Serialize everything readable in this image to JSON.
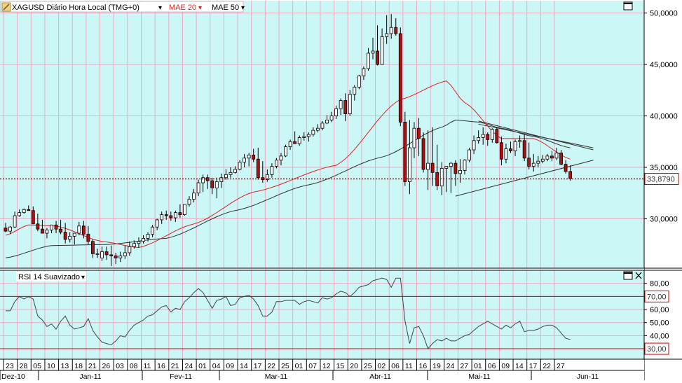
{
  "header": {
    "symbol": "XAGUSD",
    "period": "Diário",
    "timezone": "Hora Local (TMG+0)",
    "indicators": [
      {
        "label": "MAE 20",
        "color": "#e02020"
      },
      {
        "label": "MAE 50",
        "color": "#000000"
      }
    ],
    "dropdown_glyph": "▾"
  },
  "rsi_panel": {
    "label": "RSI 14 Suavizado"
  },
  "colors": {
    "plot_background": "#ccf7f7",
    "grid": "#f0a8c0",
    "bull": "#ffffff",
    "bear": "#b01010",
    "candle_outline": "#000000",
    "mae20": "#e02020",
    "mae50": "#303030",
    "last_price_line": "#cc0000",
    "rsi_line": "#444444",
    "rsi_levels": "#cc0000"
  },
  "chart_data": [
    {
      "type": "candlestick",
      "title": "XAGUSD Diário Hora Local (TMG+0)",
      "y_axis_side": "right",
      "yticks": [
        30,
        35,
        40,
        45,
        50
      ],
      "ytick_labels": [
        "30,0000",
        "35,0000",
        "40,0000",
        "45,0000",
        "50,0000"
      ],
      "ylim": [
        25.2,
        51.2
      ],
      "last_price": 33.879,
      "last_price_label": "33,8790",
      "x_labels": {
        "days": [
          "23",
          "28",
          "05",
          "10",
          "13",
          "18",
          "21",
          "26",
          "03",
          "08",
          "11",
          "16",
          "21",
          "24",
          "01",
          "04",
          "09",
          "14",
          "17",
          "22",
          "25",
          "01",
          "07",
          "12",
          "15",
          "20",
          "25",
          "02",
          "06",
          "11",
          "16",
          "19",
          "24",
          "27",
          "01",
          "06",
          "09",
          "14",
          "17",
          "22",
          "27"
        ],
        "months": [
          "Dez-10",
          "Jan-11",
          "Fev-11",
          "Mar-11",
          "Abr-11",
          "Mai-11",
          "Jun-11"
        ]
      },
      "series": [
        {
          "kind": "ohlc",
          "open": [
            29.1,
            28.8,
            29.2,
            30.3,
            30.6,
            30.9,
            30.8,
            29.5,
            29.0,
            28.6,
            28.9,
            29.4,
            29.0,
            28.7,
            28.0,
            28.3,
            28.6,
            29.3,
            28.5,
            27.8,
            26.6,
            26.2,
            26.8,
            26.5,
            26.4,
            26.2,
            26.4,
            26.7,
            27.3,
            27.6,
            27.8,
            28.1,
            28.5,
            29.2,
            29.9,
            30.4,
            30.3,
            30.1,
            30.6,
            30.4,
            31.4,
            31.9,
            32.5,
            33.5,
            34.0,
            33.7,
            33.0,
            33.6,
            34.0,
            34.3,
            34.5,
            34.8,
            35.5,
            35.9,
            36.2,
            35.8,
            34.0,
            33.8,
            34.3,
            35.1,
            35.7,
            36.1,
            37.0,
            37.5,
            37.3,
            37.9,
            38.0,
            38.2,
            38.6,
            38.8,
            39.3,
            39.6,
            40.0,
            40.7,
            41.5,
            40.2,
            42.1,
            42.8,
            43.9,
            44.6,
            46.1,
            46.3,
            45.0,
            47.7,
            48.0,
            48.6,
            48.0,
            39.4,
            33.6,
            36.9,
            38.8,
            37.8,
            34.8,
            35.4,
            34.5,
            33.2,
            34.9,
            35.1,
            35.4,
            34.4,
            34.7,
            35.7,
            36.7,
            37.6,
            37.9,
            38.2,
            37.7,
            38.7,
            37.4,
            35.8,
            36.8,
            36.6,
            37.5,
            37.6,
            35.9,
            35.1,
            35.4,
            35.6,
            35.8,
            36.1,
            35.9,
            36.4,
            35.3,
            34.6
          ],
          "high": [
            29.6,
            29.3,
            30.7,
            30.9,
            31.0,
            31.3,
            31.2,
            30.5,
            29.9,
            29.1,
            29.4,
            29.8,
            29.9,
            29.6,
            28.7,
            28.6,
            29.7,
            29.8,
            29.3,
            28.0,
            27.1,
            27.3,
            27.3,
            27.4,
            26.7,
            26.8,
            27.4,
            27.8,
            27.9,
            28.2,
            28.4,
            28.7,
            29.4,
            30.0,
            30.7,
            30.8,
            30.7,
            30.8,
            31.4,
            31.4,
            32.2,
            32.9,
            33.8,
            34.3,
            34.3,
            34.0,
            34.0,
            34.4,
            34.8,
            35.0,
            35.1,
            35.7,
            36.3,
            36.4,
            36.8,
            36.9,
            35.6,
            34.8,
            35.4,
            35.9,
            36.4,
            37.2,
            37.7,
            38.5,
            38.1,
            38.4,
            38.4,
            38.9,
            39.2,
            39.5,
            40.1,
            40.4,
            41.0,
            41.7,
            42.2,
            42.5,
            43.0,
            44.0,
            44.8,
            46.6,
            47.6,
            48.8,
            48.5,
            49.8,
            49.9,
            49.5,
            48.6,
            40.4,
            39.6,
            39.4,
            39.8,
            38.4,
            38.6,
            38.9,
            37.2,
            35.5,
            35.1,
            35.5,
            35.7,
            35.8,
            35.8,
            36.9,
            38.1,
            38.6,
            38.9,
            38.4,
            38.8,
            38.9,
            38.0,
            37.3,
            37.5,
            37.7,
            38.1,
            38.2,
            37.4,
            36.3,
            36.1,
            36.2,
            36.3,
            36.6,
            36.9,
            36.7,
            35.7,
            35.2
          ],
          "low": [
            28.7,
            28.5,
            29.1,
            30.2,
            30.5,
            30.8,
            30.4,
            28.8,
            28.6,
            28.1,
            28.6,
            28.6,
            28.5,
            27.6,
            27.7,
            27.5,
            28.4,
            28.1,
            27.5,
            26.2,
            26.2,
            25.9,
            26.0,
            25.4,
            25.6,
            25.8,
            26.1,
            26.4,
            27.1,
            27.2,
            27.6,
            27.8,
            28.2,
            28.9,
            29.5,
            29.9,
            29.8,
            29.7,
            30.1,
            30.3,
            31.2,
            31.6,
            32.2,
            32.6,
            32.9,
            32.4,
            32.0,
            33.0,
            33.8,
            34.0,
            34.4,
            34.7,
            35.0,
            35.1,
            35.5,
            33.8,
            33.5,
            33.6,
            34.0,
            34.9,
            35.2,
            36.0,
            36.7,
            37.3,
            37.1,
            37.6,
            37.5,
            38.0,
            38.4,
            38.6,
            39.2,
            39.4,
            39.7,
            40.1,
            39.5,
            40.0,
            41.5,
            42.6,
            43.5,
            44.4,
            45.5,
            44.9,
            45.0,
            47.0,
            47.5,
            47.8,
            39.0,
            33.2,
            32.4,
            35.9,
            36.1,
            34.5,
            32.8,
            33.2,
            32.8,
            32.3,
            32.6,
            32.5,
            33.2,
            33.5,
            34.3,
            35.5,
            36.3,
            37.3,
            37.2,
            37.1,
            37.4,
            37.3,
            35.2,
            35.4,
            36.4,
            36.1,
            36.9,
            35.6,
            34.8,
            34.6,
            35.0,
            35.4,
            35.6,
            35.6,
            35.7,
            35.2,
            34.4,
            33.7
          ],
          "close": [
            28.8,
            29.2,
            30.3,
            30.6,
            30.9,
            30.8,
            29.5,
            29.0,
            28.6,
            28.9,
            29.4,
            29.0,
            28.7,
            28.0,
            28.3,
            28.6,
            29.3,
            28.5,
            27.8,
            26.6,
            26.6,
            26.8,
            26.5,
            26.4,
            26.2,
            26.4,
            26.7,
            27.3,
            27.6,
            27.8,
            28.1,
            28.5,
            29.2,
            29.9,
            30.4,
            30.3,
            30.1,
            30.6,
            30.4,
            31.4,
            31.9,
            32.5,
            33.5,
            34.0,
            33.7,
            33.0,
            33.6,
            34.0,
            34.3,
            34.5,
            34.8,
            35.5,
            35.9,
            36.2,
            35.8,
            34.0,
            33.8,
            34.3,
            35.1,
            35.7,
            36.1,
            37.0,
            37.5,
            37.3,
            37.9,
            38.0,
            38.2,
            38.6,
            38.8,
            39.3,
            39.6,
            40.0,
            40.7,
            41.5,
            40.2,
            42.1,
            42.8,
            43.9,
            44.6,
            46.1,
            46.3,
            45.0,
            47.7,
            48.0,
            48.6,
            48.0,
            39.4,
            33.6,
            36.9,
            38.8,
            37.8,
            34.8,
            35.4,
            34.5,
            33.2,
            34.9,
            35.1,
            35.4,
            34.4,
            34.7,
            35.7,
            36.7,
            37.6,
            37.9,
            38.2,
            37.7,
            38.7,
            37.4,
            35.8,
            36.8,
            36.6,
            37.5,
            37.6,
            35.9,
            35.1,
            35.4,
            35.6,
            35.8,
            36.1,
            35.9,
            36.4,
            35.3,
            34.6,
            33.9
          ]
        },
        {
          "name": "MAE 20",
          "kind": "line",
          "start": [
            0,
            28.4
          ],
          "end": [
            123,
            35.8
          ],
          "points": [
            [
              0,
              28.4
            ],
            [
              5,
              29.4
            ],
            [
              11,
              29.3
            ],
            [
              21,
              27.8
            ],
            [
              29,
              27.2
            ],
            [
              41,
              29.5
            ],
            [
              54,
              32.6
            ],
            [
              72,
              35.2
            ],
            [
              86,
              41.6
            ],
            [
              96,
              43.4
            ],
            [
              100,
              41.3
            ],
            [
              108,
              37.8
            ],
            [
              115,
              37.8
            ],
            [
              123,
              35.8
            ]
          ]
        },
        {
          "name": "MAE 50",
          "kind": "line",
          "start": [
            0,
            26.2
          ],
          "end": [
            123,
            36.9
          ],
          "points": [
            [
              0,
              26.2
            ],
            [
              10,
              27.4
            ],
            [
              22,
              27.5
            ],
            [
              35,
              28.1
            ],
            [
              50,
              30.8
            ],
            [
              66,
              33.3
            ],
            [
              82,
              36.0
            ],
            [
              95,
              38.9
            ],
            [
              98,
              39.6
            ],
            [
              103,
              39.4
            ],
            [
              108,
              38.8
            ],
            [
              115,
              38.0
            ],
            [
              123,
              36.9
            ]
          ]
        }
      ],
      "trendlines": [
        {
          "from": [
            103,
            39.5
          ],
          "to": [
            128,
            36.7
          ]
        },
        {
          "from": [
            103,
            39.2
          ],
          "to": [
            128,
            36.9
          ]
        },
        {
          "from": [
            98,
            32.2
          ],
          "to": [
            128,
            35.7
          ]
        }
      ]
    },
    {
      "type": "line",
      "title": "RSI 14 Suavizado",
      "yticks": [
        40,
        50,
        60,
        70,
        80
      ],
      "ytick_labels": [
        "40,00",
        "50,00",
        "60,00",
        "70,00",
        "80,00"
      ],
      "ylim": [
        22,
        90
      ],
      "levels": [
        {
          "value": 70,
          "label": "70,00"
        },
        {
          "value": 30,
          "label": "30,00"
        }
      ],
      "values": [
        59,
        59,
        66,
        70,
        68,
        70,
        68,
        55,
        52,
        47,
        49,
        45,
        51,
        55,
        48,
        45,
        46,
        47,
        53,
        44,
        39,
        35,
        34,
        33,
        36,
        40,
        39,
        44,
        48,
        50,
        52,
        55,
        56,
        59,
        62,
        63,
        58,
        61,
        60,
        66,
        69,
        73,
        76,
        73,
        67,
        61,
        67,
        68,
        70,
        63,
        64,
        69,
        70,
        71,
        68,
        63,
        55,
        55,
        58,
        66,
        66,
        67,
        67,
        67,
        64,
        66,
        67,
        66,
        65,
        69,
        68,
        69,
        72,
        74,
        73,
        70,
        73,
        77,
        78,
        79,
        82,
        83,
        84,
        83,
        77,
        84,
        84,
        51,
        34,
        46,
        47,
        40,
        30,
        34,
        37,
        36,
        38,
        36,
        36,
        38,
        40,
        41,
        44,
        47,
        49,
        51,
        49,
        47,
        45,
        48,
        46,
        49,
        51,
        43,
        44,
        44,
        45,
        47,
        48,
        48,
        46,
        42,
        38,
        37
      ]
    }
  ]
}
